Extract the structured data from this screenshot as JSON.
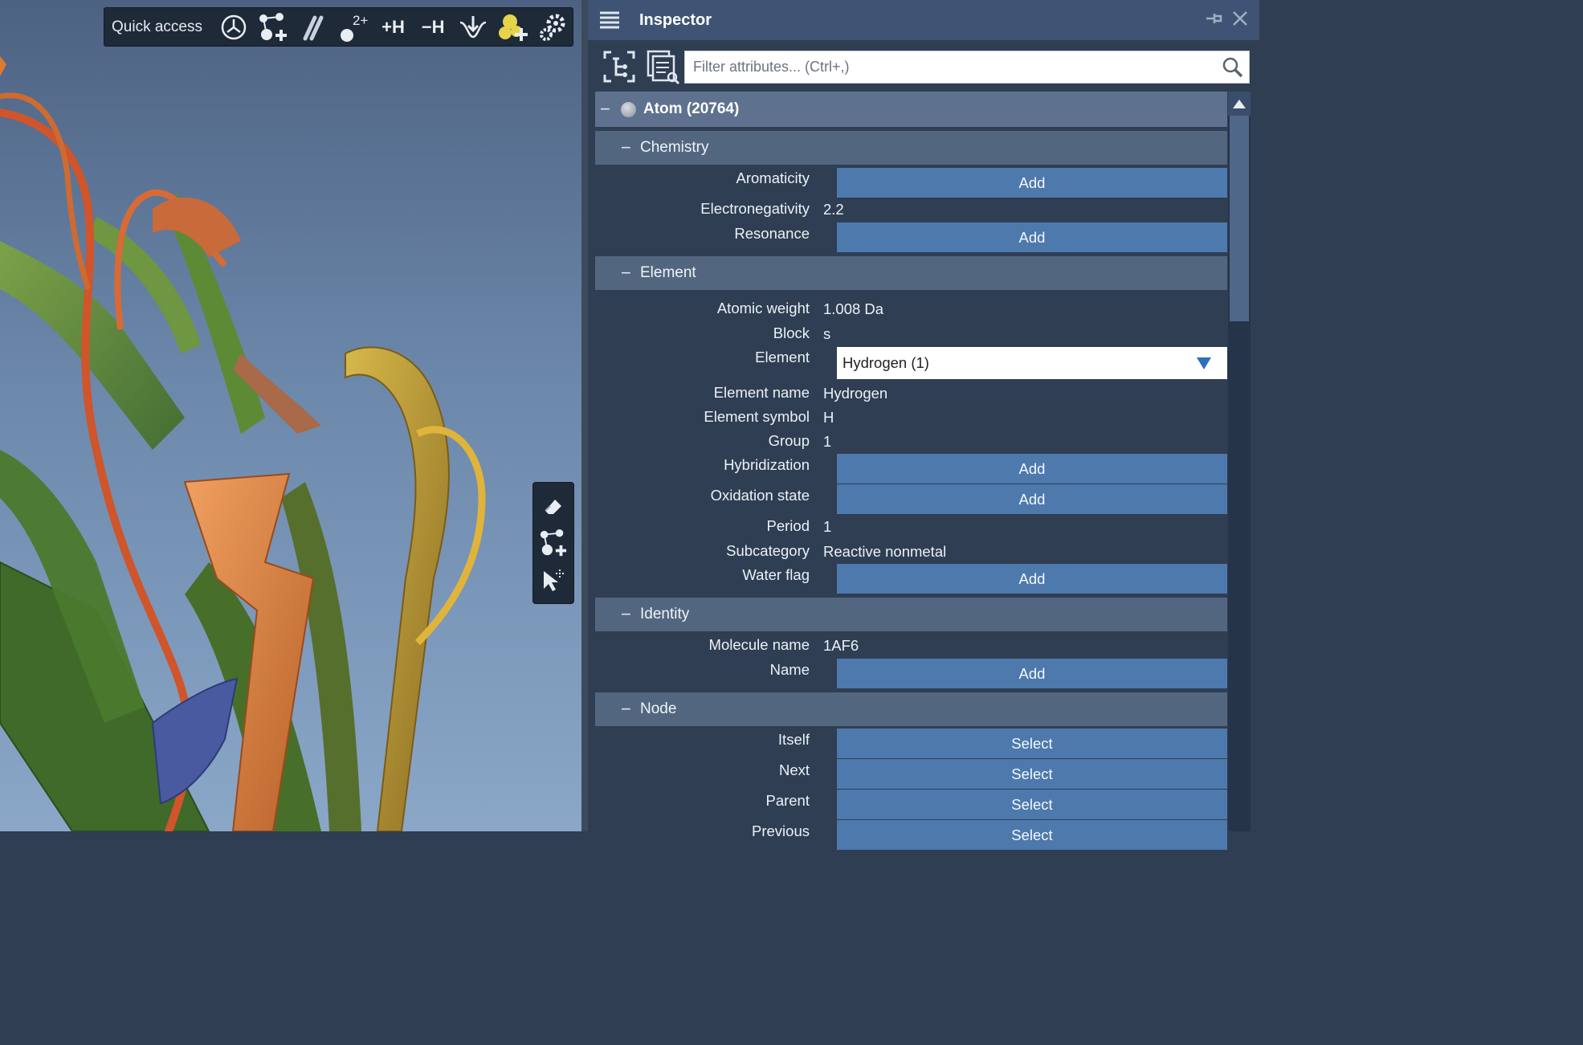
{
  "viewport": {
    "quick_access": {
      "label": "Quick access",
      "buttons": [
        {
          "name": "recenter-icon"
        },
        {
          "name": "add-molecule-icon"
        },
        {
          "name": "bond-icon"
        },
        {
          "name": "charge-icon",
          "text": "2+"
        },
        {
          "name": "add-hydrogens-icon",
          "text": "+H"
        },
        {
          "name": "remove-hydrogens-icon",
          "text": "−H"
        },
        {
          "name": "minimize-icon"
        },
        {
          "name": "add-atom-icon"
        },
        {
          "name": "settings-icon"
        }
      ]
    },
    "side_tools": [
      "eraser-icon",
      "add-molecule-icon",
      "select-cursor-icon"
    ]
  },
  "inspector": {
    "title": "Inspector",
    "filter_placeholder": "Filter attributes... (Ctrl+,)",
    "atom_label": "Atom (20764)",
    "categories": [
      {
        "label": "Chemistry",
        "props": [
          {
            "name": "Aromaticity",
            "kind": "button",
            "value": "Add"
          },
          {
            "name": "Electronegativity",
            "kind": "text",
            "value": "2.2"
          },
          {
            "name": "Resonance",
            "kind": "button",
            "value": "Add"
          }
        ]
      },
      {
        "label": "Element",
        "props": [
          {
            "name": "Atomic weight",
            "kind": "text",
            "value": "1.008 Da"
          },
          {
            "name": "Block",
            "kind": "text",
            "value": "s"
          },
          {
            "name": "Element",
            "kind": "select",
            "value": "Hydrogen (1)"
          },
          {
            "name": "Element name",
            "kind": "text",
            "value": "Hydrogen"
          },
          {
            "name": "Element symbol",
            "kind": "text",
            "value": "H"
          },
          {
            "name": "Group",
            "kind": "text",
            "value": "1"
          },
          {
            "name": "Hybridization",
            "kind": "button",
            "value": "Add"
          },
          {
            "name": "Oxidation state",
            "kind": "button",
            "value": "Add"
          },
          {
            "name": "Period",
            "kind": "text",
            "value": "1"
          },
          {
            "name": "Subcategory",
            "kind": "text",
            "value": "Reactive nonmetal"
          },
          {
            "name": "Water flag",
            "kind": "button",
            "value": "Add"
          }
        ]
      },
      {
        "label": "Identity",
        "props": [
          {
            "name": "Molecule name",
            "kind": "text",
            "value": "1AF6"
          },
          {
            "name": "Name",
            "kind": "button",
            "value": "Add"
          }
        ]
      },
      {
        "label": "Node",
        "props": [
          {
            "name": "Itself",
            "kind": "button",
            "value": "Select"
          },
          {
            "name": "Next",
            "kind": "button",
            "value": "Select"
          },
          {
            "name": "Parent",
            "kind": "button",
            "value": "Select"
          },
          {
            "name": "Previous",
            "kind": "button",
            "value": "Select"
          }
        ]
      }
    ]
  }
}
